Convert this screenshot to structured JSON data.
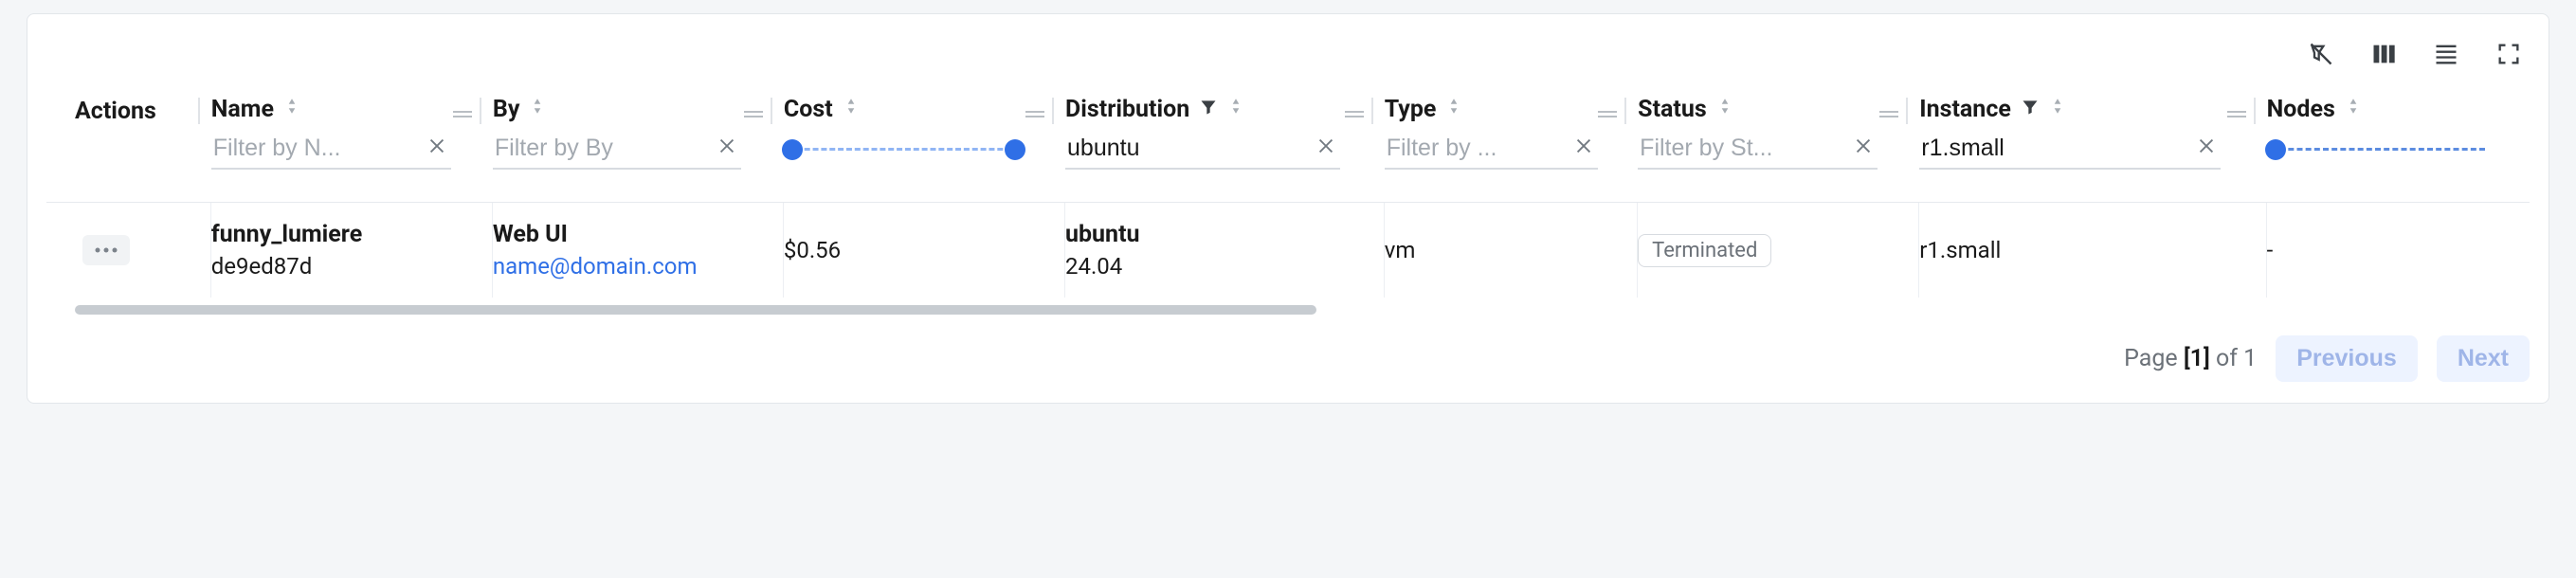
{
  "columns": {
    "actions_label": "Actions",
    "name": {
      "label": "Name",
      "placeholder": "Filter by N...",
      "value": ""
    },
    "by": {
      "label": "By",
      "placeholder": "Filter by By",
      "value": ""
    },
    "cost": {
      "label": "Cost"
    },
    "distribution": {
      "label": "Distribution",
      "placeholder": "",
      "value": "ubuntu",
      "filter_active": true
    },
    "type": {
      "label": "Type",
      "placeholder": "Filter by ...",
      "value": ""
    },
    "status": {
      "label": "Status",
      "placeholder": "Filter by St...",
      "value": ""
    },
    "instance": {
      "label": "Instance",
      "placeholder": "",
      "value": "r1.small",
      "filter_active": true
    },
    "nodes": {
      "label": "Nodes"
    }
  },
  "rows": [
    {
      "name_primary": "funny_lumiere",
      "name_secondary": "de9ed87d",
      "by_primary": "Web UI",
      "by_link": "name@domain.com",
      "cost": "$0.56",
      "distribution_primary": "ubuntu",
      "distribution_secondary": "24.04",
      "type": "vm",
      "status": "Terminated",
      "instance": "r1.small",
      "nodes": "-"
    }
  ],
  "pagination": {
    "prefix": "Page ",
    "current": "[1]",
    "suffix": " of 1",
    "previous_label": "Previous",
    "next_label": "Next"
  }
}
